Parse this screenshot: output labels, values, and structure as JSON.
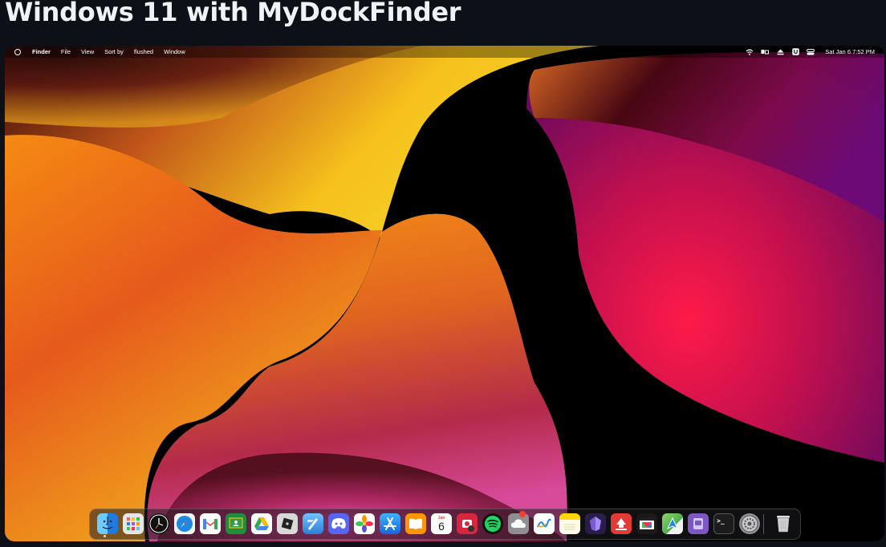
{
  "page": {
    "title": "Windows 11 with MyDockFinder"
  },
  "menubar": {
    "app_name": "Finder",
    "items": [
      "File",
      "View",
      "Sort by",
      "flushed",
      "Window"
    ],
    "clock": "Sat Jan 6 7:52 PM",
    "status_icons": [
      "wifi-icon",
      "network-icon",
      "eject-icon",
      "user-icon",
      "control-center-icon"
    ]
  },
  "dock": {
    "apps": [
      {
        "name": "finder",
        "color": "#2b8cf0"
      },
      {
        "name": "launchpad",
        "color": "#e6e6e6"
      },
      {
        "name": "clock",
        "color": "#111111"
      },
      {
        "name": "safari",
        "color": "#1e88e5"
      },
      {
        "name": "gmail",
        "color": "#ffffff"
      },
      {
        "name": "google-classroom",
        "color": "#1e8e3e"
      },
      {
        "name": "google-drive",
        "color": "#ffffff"
      },
      {
        "name": "roblox",
        "color": "#d9d9d9"
      },
      {
        "name": "xcode",
        "color": "#4aa3e8"
      },
      {
        "name": "discord",
        "color": "#5865f2"
      },
      {
        "name": "photos",
        "color": "#ffffff"
      },
      {
        "name": "app-store",
        "color": "#1b8bf5"
      },
      {
        "name": "books",
        "color": "#ff9500"
      },
      {
        "name": "calendar",
        "color": "#ffffff"
      },
      {
        "name": "photo-booth",
        "color": "#d7263d"
      },
      {
        "name": "spotify",
        "color": "#111111"
      },
      {
        "name": "icloud",
        "color": "#8e8e93"
      },
      {
        "name": "freeform",
        "color": "#ffffff"
      },
      {
        "name": "notes",
        "color": "#ffd60a"
      },
      {
        "name": "obsidian",
        "color": "#2a1d4a"
      },
      {
        "name": "pdf-expert",
        "color": "#e53935"
      },
      {
        "name": "final-cut",
        "color": "#1a1a1a"
      },
      {
        "name": "maps",
        "color": "#4caf50"
      },
      {
        "name": "podcasts-purple",
        "color": "#7e57c2"
      },
      {
        "name": "terminal",
        "color": "#1c1c1c"
      },
      {
        "name": "system-settings",
        "color": "#8e8e93"
      },
      {
        "name": "trash",
        "color": "#d0d0d0"
      }
    ],
    "calendar_month": "Jan",
    "calendar_day": "6",
    "terminal_prompt": ">_"
  }
}
